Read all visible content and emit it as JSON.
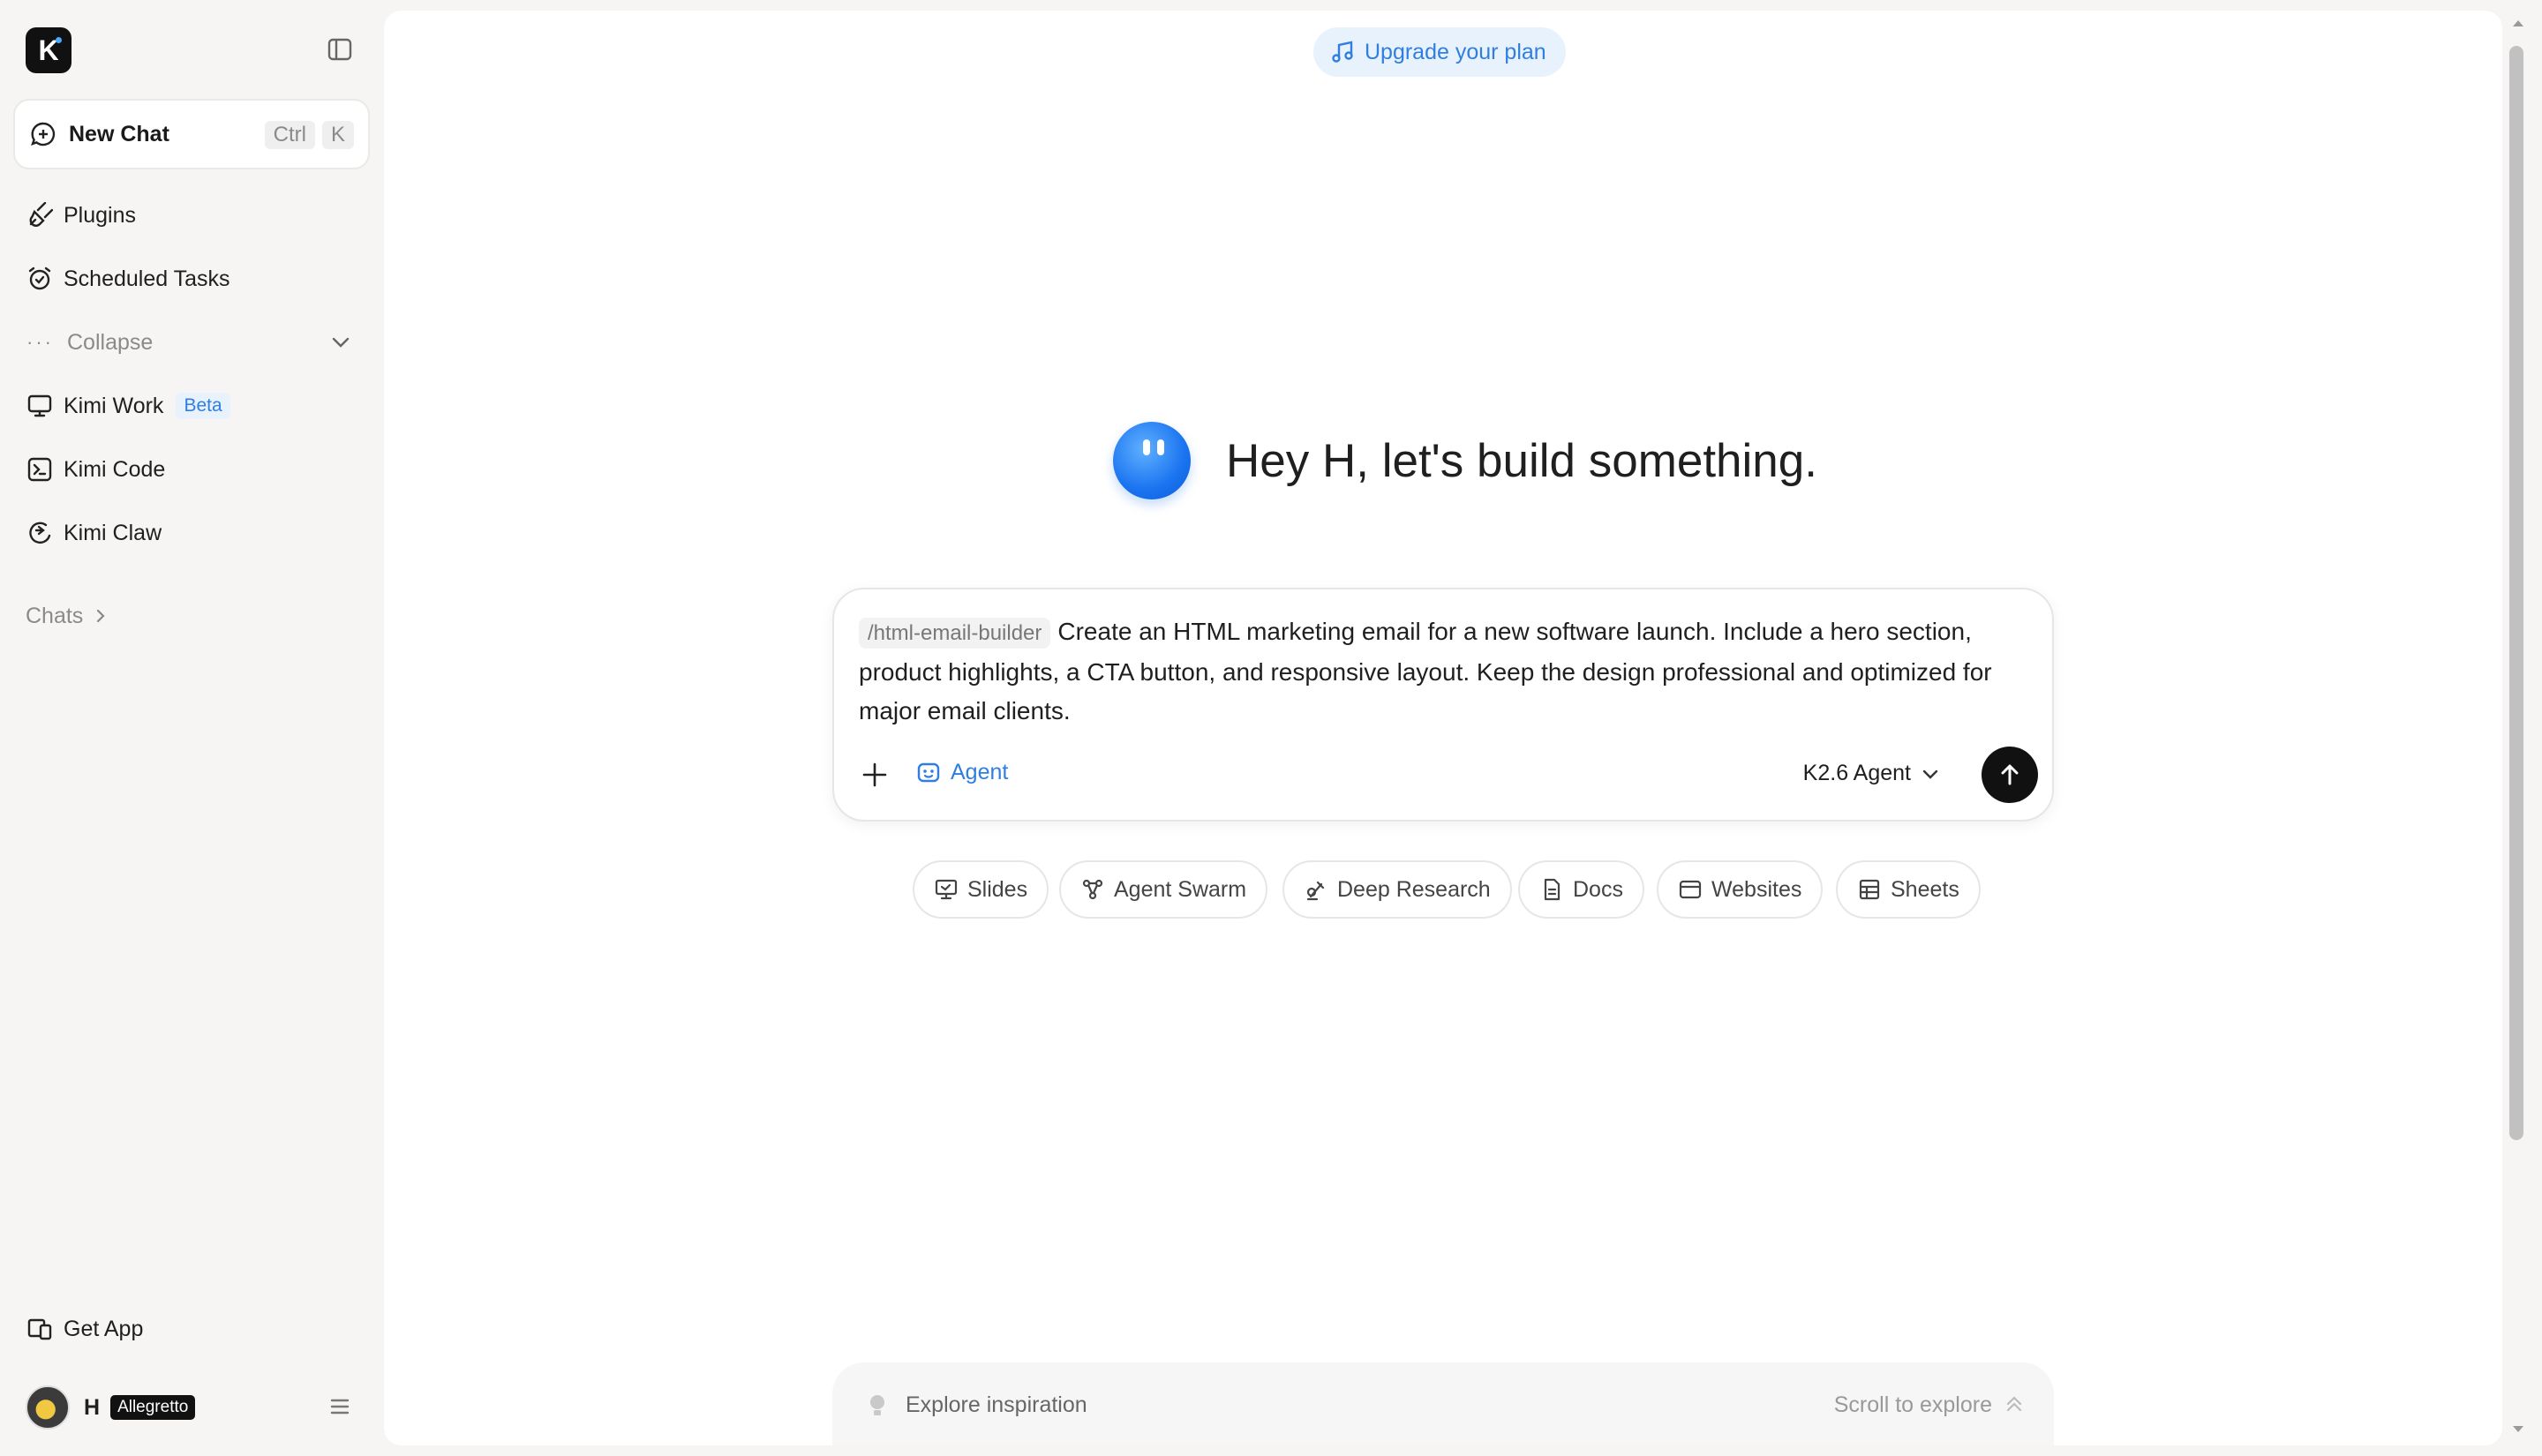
{
  "sidebar": {
    "logo_letter": "K",
    "new_chat": {
      "label": "New Chat",
      "shortcut": [
        "Ctrl",
        "K"
      ]
    },
    "items": [
      {
        "label": "Plugins",
        "icon": "plug-icon"
      },
      {
        "label": "Scheduled Tasks",
        "icon": "alarm-clock-icon"
      }
    ],
    "collapse_label": "Collapse",
    "products": [
      {
        "label": "Kimi Work",
        "badge": "Beta",
        "icon": "monitor-icon"
      },
      {
        "label": "Kimi Code",
        "icon": "terminal-icon"
      },
      {
        "label": "Kimi Claw",
        "icon": "claw-icon"
      }
    ],
    "chats_label": "Chats",
    "get_app_label": "Get App",
    "user": {
      "name": "H",
      "plan": "Allegretto"
    }
  },
  "main": {
    "upgrade_label": "Upgrade your plan",
    "greeting": "Hey H, let's build something.",
    "composer": {
      "skill_tag": "/html-email-builder",
      "prompt_text": "Create an HTML marketing email for a new software launch. Include a hero section, product highlights, a CTA button, and responsive layout. Keep the design professional and optimized for major email clients.",
      "mode_label": "Agent",
      "model_label": "K2.6 Agent"
    },
    "chips": [
      {
        "label": "Slides",
        "icon": "slides-icon"
      },
      {
        "label": "Agent Swarm",
        "icon": "swarm-icon"
      },
      {
        "label": "Deep Research",
        "icon": "research-icon"
      },
      {
        "label": "Docs",
        "icon": "doc-icon"
      },
      {
        "label": "Websites",
        "icon": "browser-icon"
      },
      {
        "label": "Sheets",
        "icon": "sheet-icon"
      }
    ],
    "explore": {
      "left_label": "Explore inspiration",
      "right_label": "Scroll to explore"
    }
  },
  "colors": {
    "accent": "#2f7ee0",
    "sidebar_bg": "#f6f5f3",
    "send_button": "#111111"
  }
}
